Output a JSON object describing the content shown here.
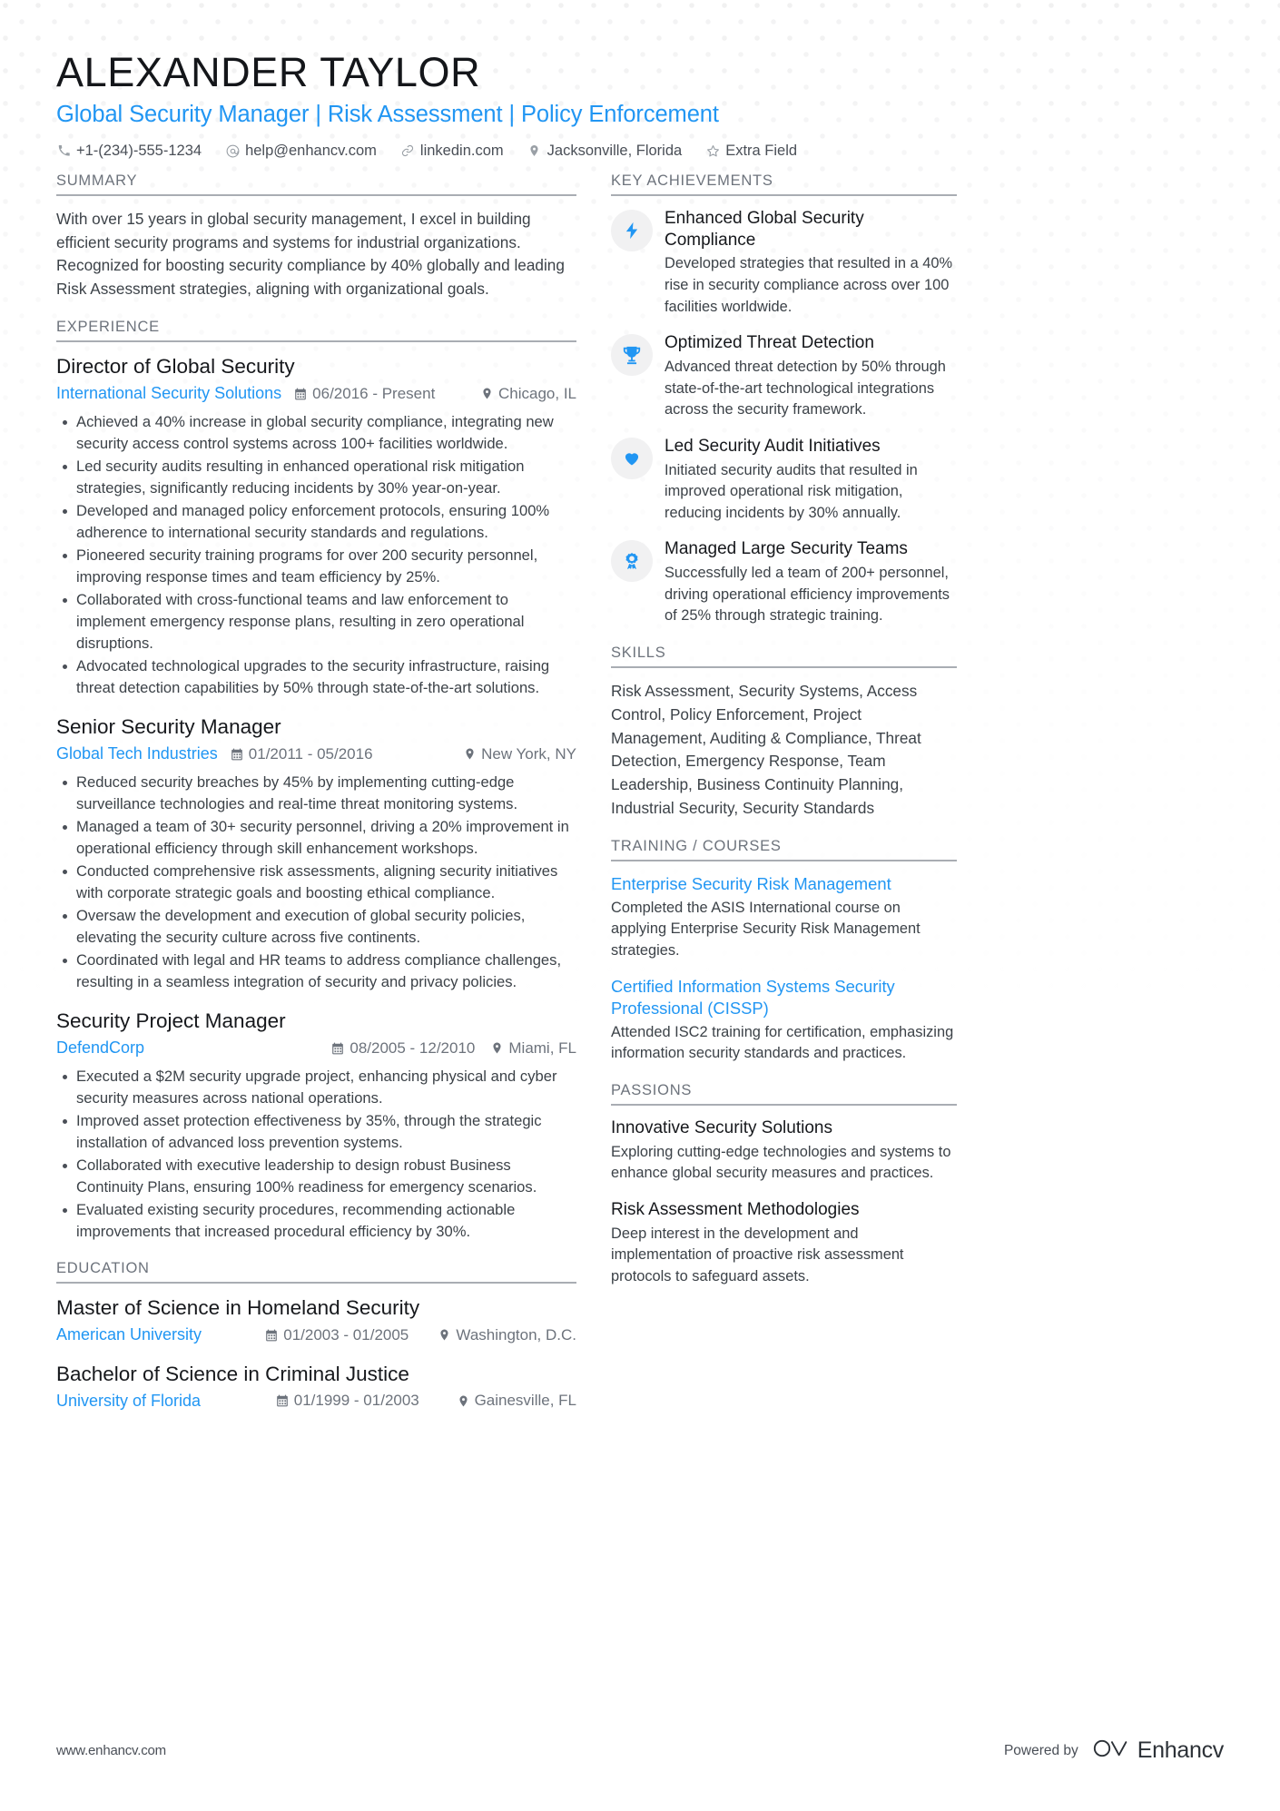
{
  "colors": {
    "accent": "#2196f3",
    "heading": "#16181c",
    "body": "#3c4248",
    "muted": "#6d737c",
    "rule": "#a9adb3",
    "icon_bubble": "#f1f1f2"
  },
  "header": {
    "name": "ALEXANDER TAYLOR",
    "headline": "Global Security Manager | Risk Assessment | Policy Enforcement",
    "contacts": [
      {
        "icon": "phone-icon",
        "text": "+1-(234)-555-1234"
      },
      {
        "icon": "email-icon",
        "text": "help@enhancv.com"
      },
      {
        "icon": "link-icon",
        "text": "linkedin.com"
      },
      {
        "icon": "location-pin-icon",
        "text": "Jacksonville, Florida"
      },
      {
        "icon": "star-icon",
        "text": "Extra Field"
      }
    ]
  },
  "left": {
    "summary": {
      "heading": "SUMMARY",
      "text": "With over 15 years in global security management, I excel in building efficient security programs and systems for industrial organizations. Recognized for boosting security compliance by 40% globally and leading Risk Assessment strategies, aligning with organizational goals."
    },
    "experience": {
      "heading": "EXPERIENCE",
      "entries": [
        {
          "title": "Director of Global Security",
          "org": "International Security Solutions",
          "date": "06/2016 - Present",
          "location": "Chicago, IL",
          "bullets": [
            "Achieved a 40% increase in global security compliance, integrating new security access control systems across 100+ facilities worldwide.",
            "Led security audits resulting in enhanced operational risk mitigation strategies, significantly reducing incidents by 30% year-on-year.",
            "Developed and managed policy enforcement protocols, ensuring 100% adherence to international security standards and regulations.",
            "Pioneered security training programs for over 200 security personnel, improving response times and team efficiency by 25%.",
            "Collaborated with cross-functional teams and law enforcement to implement emergency response plans, resulting in zero operational disruptions.",
            "Advocated technological upgrades to the security infrastructure, raising threat detection capabilities by 50% through state-of-the-art solutions."
          ]
        },
        {
          "title": "Senior Security Manager",
          "org": "Global Tech Industries",
          "date": "01/2011 - 05/2016",
          "location": "New York, NY",
          "bullets": [
            "Reduced security breaches by 45% by implementing cutting-edge surveillance technologies and real-time threat monitoring systems.",
            "Managed a team of 30+ security personnel, driving a 20% improvement in operational efficiency through skill enhancement workshops.",
            "Conducted comprehensive risk assessments, aligning security initiatives with corporate strategic goals and boosting ethical compliance.",
            "Oversaw the development and execution of global security policies, elevating the security culture across five continents.",
            "Coordinated with legal and HR teams to address compliance challenges, resulting in a seamless integration of security and privacy policies."
          ]
        },
        {
          "title": "Security Project Manager",
          "org": "DefendCorp",
          "date": "08/2005 - 12/2010",
          "location": "Miami, FL",
          "bullets": [
            "Executed a $2M security upgrade project, enhancing physical and cyber security measures across national operations.",
            "Improved asset protection effectiveness by 35%, through the strategic installation of advanced loss prevention systems.",
            "Collaborated with executive leadership to design robust Business Continuity Plans, ensuring 100% readiness for emergency scenarios.",
            "Evaluated existing security procedures, recommending actionable improvements that increased procedural efficiency by 30%."
          ]
        }
      ]
    },
    "education": {
      "heading": "EDUCATION",
      "entries": [
        {
          "title": "Master of Science in Homeland Security",
          "org": "American University",
          "date": "01/2003 - 01/2005",
          "location": "Washington, D.C."
        },
        {
          "title": "Bachelor of Science in Criminal Justice",
          "org": "University of Florida",
          "date": "01/1999 - 01/2003",
          "location": "Gainesville, FL"
        }
      ]
    }
  },
  "right": {
    "achievements": {
      "heading": "KEY ACHIEVEMENTS",
      "items": [
        {
          "icon": "lightning-bolt-icon",
          "title": "Enhanced Global Security Compliance",
          "desc": "Developed strategies that resulted in a 40% rise in security compliance across over 100 facilities worldwide."
        },
        {
          "icon": "trophy-icon",
          "title": "Optimized Threat Detection",
          "desc": "Advanced threat detection by 50% through state-of-the-art technological integrations across the security framework."
        },
        {
          "icon": "heart-icon",
          "title": "Led Security Audit Initiatives",
          "desc": "Initiated security audits that resulted in improved operational risk mitigation, reducing incidents by 30% annually."
        },
        {
          "icon": "award-ribbon-icon",
          "title": "Managed Large Security Teams",
          "desc": "Successfully led a team of 200+ personnel, driving operational efficiency improvements of 25% through strategic training."
        }
      ]
    },
    "skills": {
      "heading": "SKILLS",
      "text": "Risk Assessment, Security Systems, Access Control, Policy Enforcement, Project Management, Auditing & Compliance, Threat Detection, Emergency Response, Team Leadership, Business Continuity Planning, Industrial Security, Security Standards"
    },
    "training": {
      "heading": "TRAINING / COURSES",
      "items": [
        {
          "title": "Enterprise Security Risk Management",
          "desc": "Completed the ASIS International course on applying Enterprise Security Risk Management strategies."
        },
        {
          "title": "Certified Information Systems Security Professional (CISSP)",
          "desc": "Attended ISC2 training for certification, emphasizing information security standards and practices."
        }
      ]
    },
    "passions": {
      "heading": "PASSIONS",
      "items": [
        {
          "title": "Innovative Security Solutions",
          "desc": "Exploring cutting-edge technologies and systems to enhance global security measures and practices."
        },
        {
          "title": "Risk Assessment Methodologies",
          "desc": "Deep interest in the development and implementation of proactive risk assessment protocols to safeguard assets."
        }
      ]
    }
  },
  "footer": {
    "url": "www.enhancv.com",
    "powered_by": "Powered by",
    "brand": "Enhancv",
    "brand_logo": "enhancv-infinity-icon"
  }
}
